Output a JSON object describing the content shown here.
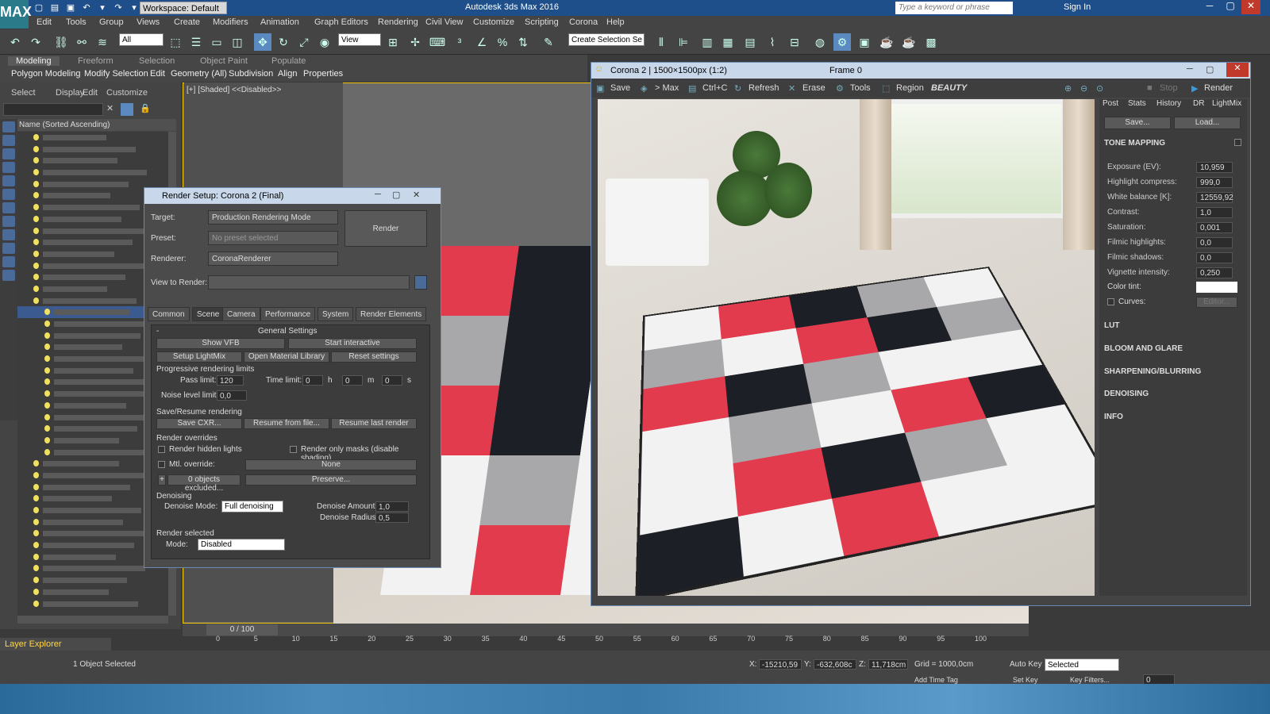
{
  "app": {
    "title": "Autodesk 3ds Max 2016",
    "logo": "MAX",
    "workspace": "Workspace: Default",
    "search_placeholder": "Type a keyword or phrase",
    "sign_in": "Sign In"
  },
  "menu": [
    "Edit",
    "Tools",
    "Group",
    "Views",
    "Create",
    "Modifiers",
    "Animation",
    "Graph Editors",
    "Rendering",
    "Civil View",
    "Customize",
    "Scripting",
    "Corona",
    "Help"
  ],
  "toolbar": {
    "filter": "All",
    "ref_coord": "View",
    "selection_set_placeholder": "Create Selection Se"
  },
  "ribbon": {
    "tabs": [
      "Modeling",
      "Freeform",
      "Selection",
      "Object Paint",
      "Populate"
    ],
    "sub": [
      "Polygon Modeling",
      "Modify Selection",
      "Edit",
      "Geometry (All)",
      "Subdivision",
      "Align",
      "Properties"
    ]
  },
  "scene_explorer": {
    "menu": [
      "Select",
      "Display",
      "Edit",
      "Customize"
    ],
    "column_header": "Name (Sorted Ascending)",
    "footer": "Layer Explorer"
  },
  "viewport": {
    "label": "[+]",
    "shading": "[Shaded]",
    "disabled": "<<Disabled>>"
  },
  "timeline": {
    "frame_counter": "0 / 100",
    "ticks": [
      "0",
      "5",
      "10",
      "15",
      "20",
      "25",
      "30",
      "35",
      "40",
      "45",
      "50",
      "55",
      "60",
      "65",
      "70",
      "75",
      "80",
      "85",
      "90",
      "95",
      "100"
    ]
  },
  "status": {
    "selection": "1 Object Selected",
    "x_label": "X:",
    "x": "-15210,59",
    "y_label": "Y:",
    "y": "-632,608c",
    "z_label": "Z:",
    "z": "11,718cm",
    "grid": "Grid = 1000,0cm",
    "auto_key": "Auto Key",
    "set_key": "Set Key",
    "key_mode": "Selected",
    "key_filters": "Key Filters...",
    "add_time_tag": "Add Time Tag",
    "frame": "0"
  },
  "render_setup": {
    "title": "Render Setup: Corona 2 (Final)",
    "target_label": "Target:",
    "target": "Production Rendering Mode",
    "preset_label": "Preset:",
    "preset": "No preset selected",
    "renderer_label": "Renderer:",
    "renderer": "CoronaRenderer",
    "view_label": "View to Render:",
    "render_button": "Render",
    "tabs": [
      "Common",
      "Scene",
      "Camera",
      "Performance",
      "System",
      "Render Elements"
    ],
    "collapse": "-",
    "general_settings": "General Settings",
    "show_vfb": "Show VFB",
    "start_interactive": "Start interactive",
    "setup_lightmix": "Setup LightMix",
    "open_material_library": "Open Material Library",
    "reset_settings": "Reset settings",
    "progressive_title": "Progressive rendering limits",
    "pass_limit_label": "Pass limit:",
    "pass_limit": "120",
    "time_limit_label": "Time limit:",
    "time_h": "0",
    "time_m": "0",
    "time_s": "0",
    "h": "h",
    "m": "m",
    "s": "s",
    "noise_label": "Noise level limit:",
    "noise": "0,0",
    "save_resume_title": "Save/Resume rendering",
    "save_cxr": "Save CXR...",
    "resume_file": "Resume from file...",
    "resume_last": "Resume last render",
    "overrides_title": "Render overrides",
    "render_hidden": "Render hidden lights",
    "render_masks": "Render only masks (disable shading)",
    "mtl_override": "Mtl. override:",
    "none": "None",
    "excluded": "0 objects excluded...",
    "plus": "+",
    "preserve": "Preserve...",
    "denoising_title": "Denoising",
    "denoise_mode_label": "Denoise Mode:",
    "denoise_mode": "Full denoising",
    "denoise_amount_label": "Denoise Amount:",
    "denoise_amount": "1,0",
    "denoise_radius_label": "Denoise Radius:",
    "denoise_radius": "0,5",
    "render_selected_title": "Render selected",
    "mode_label": "Mode:",
    "mode": "Disabled"
  },
  "vfb": {
    "title": "Corona 2 | 1500×1500px (1:2)",
    "frame": "Frame 0",
    "save": "Save",
    "to_max": "> Max",
    "ctrl_c": "Ctrl+C",
    "refresh": "Refresh",
    "erase": "Erase",
    "tools": "Tools",
    "region": "Region",
    "beauty": "BEAUTY",
    "stop": "Stop",
    "render": "Render",
    "side_tabs": [
      "Post",
      "Stats",
      "History",
      "DR",
      "LightMix"
    ],
    "save_btn": "Save...",
    "load_btn": "Load...",
    "tone_mapping": "TONE MAPPING",
    "params": [
      {
        "label": "Exposure (EV):",
        "value": "10,959"
      },
      {
        "label": "Highlight compress:",
        "value": "999,0"
      },
      {
        "label": "White balance [K]:",
        "value": "12559,92"
      },
      {
        "label": "Contrast:",
        "value": "1,0"
      },
      {
        "label": "Saturation:",
        "value": "0,001"
      },
      {
        "label": "Filmic highlights:",
        "value": "0,0"
      },
      {
        "label": "Filmic shadows:",
        "value": "0,0"
      },
      {
        "label": "Vignette intensity:",
        "value": "0,250"
      }
    ],
    "color_tint": "Color tint:",
    "curves": "Curves:",
    "editor": "Editor...",
    "sections": [
      "LUT",
      "BLOOM AND GLARE",
      "SHARPENING/BLURRING",
      "DENOISING",
      "INFO"
    ]
  },
  "colors": {
    "rug": [
      "white",
      "red",
      "black",
      "gray",
      "white",
      "gray",
      "white",
      "red",
      "black",
      "gray",
      "red",
      "black",
      "gray",
      "white",
      "white",
      "white",
      "gray",
      "white",
      "red",
      "black",
      "white",
      "red",
      "black",
      "gray",
      "white",
      "black",
      "white",
      "red",
      "white",
      "white"
    ]
  }
}
